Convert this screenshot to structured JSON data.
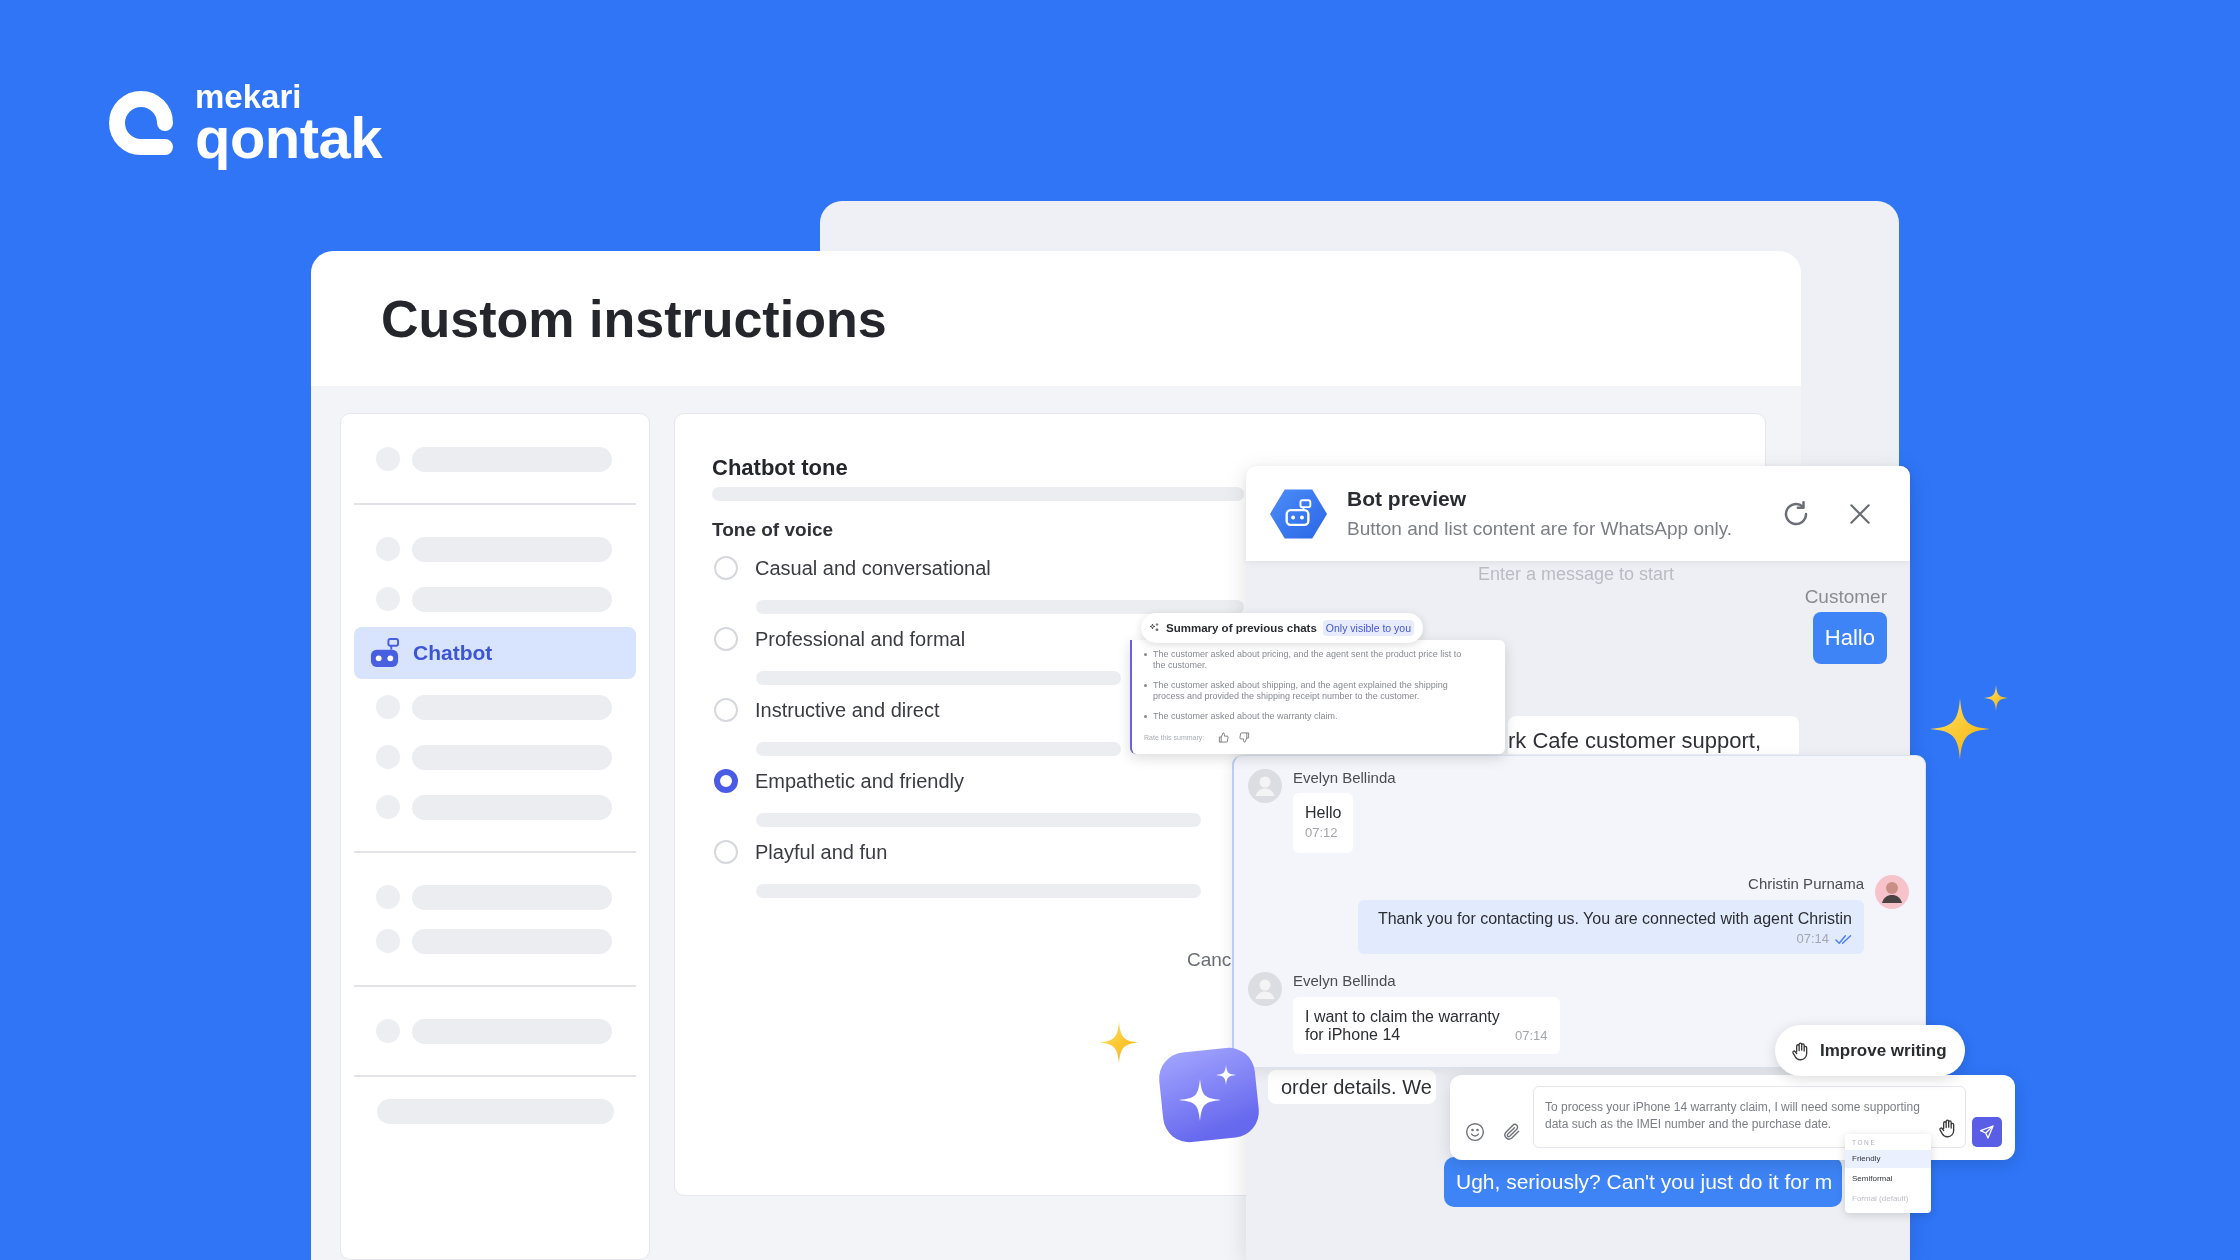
{
  "brand": {
    "parent": "mekari",
    "name": "qontak"
  },
  "page": {
    "title": "Custom instructions"
  },
  "sidebar": {
    "items": [
      {
        "label": "Chatbot",
        "selected": true
      }
    ]
  },
  "settings": {
    "section_title": "Chatbot tone",
    "field_label": "Tone of voice",
    "options": [
      {
        "label": "Casual and conversational",
        "selected": false
      },
      {
        "label": "Professional and formal",
        "selected": false
      },
      {
        "label": "Instructive and direct",
        "selected": false
      },
      {
        "label": "Empathetic and friendly",
        "selected": true
      },
      {
        "label": "Playful and fun",
        "selected": false
      }
    ],
    "cancel_button": "Canc"
  },
  "bot_preview": {
    "title": "Bot preview",
    "subtitle": "Button and list content are for WhatsApp only.",
    "empty_hint": "Enter a message to start",
    "messages": [
      {
        "kind": "customer",
        "sender": "Customer",
        "text": "Hallo"
      },
      {
        "kind": "bot",
        "text": "rk Cafe customer support,"
      },
      {
        "kind": "bot",
        "text": "order details. We"
      },
      {
        "kind": "customer",
        "text": "Ugh, seriously? Can't you just do it for m"
      }
    ]
  },
  "conversation": {
    "messages": [
      {
        "kind": "incoming",
        "sender": "Evelyn Bellinda",
        "text": "Hello",
        "time": "07:12"
      },
      {
        "kind": "outgoing",
        "sender": "Christin Purnama",
        "text": "Thank you for contacting us. You are connected with agent Christin",
        "time": "07:14",
        "read": true
      },
      {
        "kind": "incoming",
        "sender": "Evelyn Bellinda",
        "text": "I want to claim the warranty for iPhone 14",
        "time": "07:14"
      }
    ]
  },
  "summary_popup": {
    "title": "Summary of previous chats",
    "badge": "Only visible to you",
    "points": [
      "The customer asked about pricing, and the agent sent the product price list to the customer.",
      "The customer asked about shipping, and the agent explained the shipping process and provided the shipping receipt number to the customer.",
      "The customer asked about the warranty claim."
    ],
    "rating_prompt": "Rate this summary:"
  },
  "assistant": {
    "improve_button": "Improve writing",
    "draft": "To process your iPhone 14 warranty claim, I will need some supporting data such as the IMEI number and the purchase date.",
    "tone_menu": {
      "heading": "TONE",
      "options": [
        {
          "label": "Friendly",
          "selected": true,
          "disabled": false
        },
        {
          "label": "Semiformal",
          "selected": false,
          "disabled": false
        },
        {
          "label": "Formal (default)",
          "selected": false,
          "disabled": true
        }
      ]
    }
  }
}
